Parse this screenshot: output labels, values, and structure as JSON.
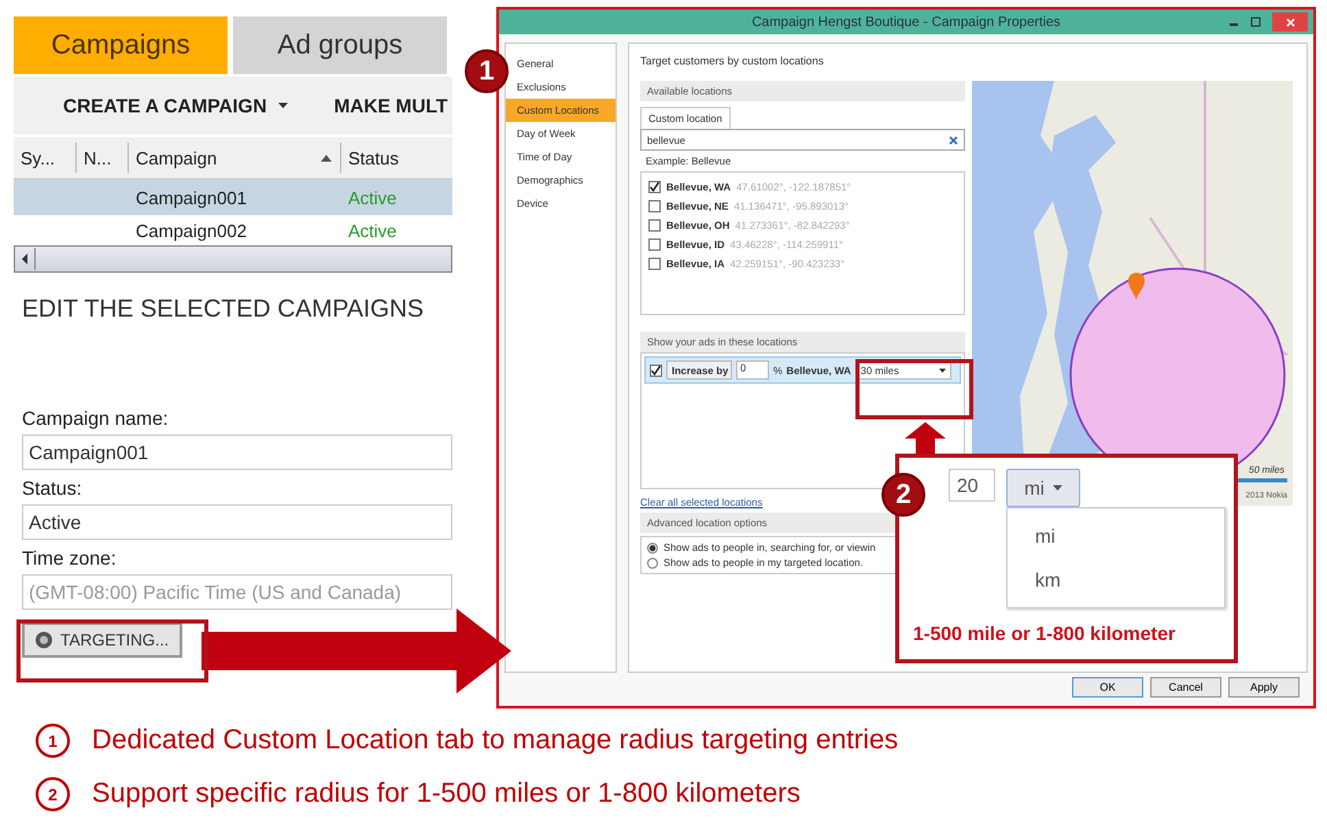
{
  "campaign_panel": {
    "tabs": [
      {
        "label": "Campaigns",
        "selected": true
      },
      {
        "label": "Ad groups",
        "selected": false
      }
    ],
    "toolbar": [
      {
        "label": "CREATE A CAMPAIGN",
        "dropdown": true
      },
      {
        "label": "MAKE MULT",
        "dropdown": false
      }
    ],
    "table": {
      "columns": [
        {
          "label": "Sy...",
          "sorted": false
        },
        {
          "label": "N...",
          "sorted": false
        },
        {
          "label": "Campaign",
          "sorted": true
        },
        {
          "label": "Status",
          "sorted": false
        }
      ],
      "rows": [
        {
          "campaign": "Campaign001",
          "status": "Active",
          "selected": true
        },
        {
          "campaign": "Campaign002",
          "status": "Active",
          "selected": false
        }
      ]
    },
    "edit": {
      "heading": "EDIT THE SELECTED CAMPAIGNS",
      "fields": [
        {
          "label": "Campaign name:",
          "value": "Campaign001",
          "disabled": false
        },
        {
          "label": "Status:",
          "value": "Active",
          "disabled": false
        },
        {
          "label": "Time zone:",
          "value": "(GMT-08:00) Pacific Time (US and Canada)",
          "disabled": true
        }
      ],
      "targeting_button": "TARGETING..."
    }
  },
  "dialog": {
    "title": "Campaign Hengst Boutique - Campaign Properties",
    "nav": [
      {
        "label": "General",
        "selected": false
      },
      {
        "label": "Exclusions",
        "selected": false
      },
      {
        "label": "Custom Locations",
        "selected": true
      },
      {
        "label": "Day of Week",
        "selected": false
      },
      {
        "label": "Time of Day",
        "selected": false
      },
      {
        "label": "Demographics",
        "selected": false
      },
      {
        "label": "Device",
        "selected": false
      }
    ],
    "heading": "Target customers by custom locations",
    "available": {
      "title": "Available locations",
      "tab": "Custom location",
      "search": "bellevue",
      "hint": "Example: Bellevue",
      "results": [
        {
          "name": "Bellevue, WA",
          "coords": "47.61002°, -122.187851°",
          "checked": true
        },
        {
          "name": "Bellevue, NE",
          "coords": "41.136471°, -95.893013°",
          "checked": false
        },
        {
          "name": "Bellevue, OH",
          "coords": "41.273361°, -82.842293°",
          "checked": false
        },
        {
          "name": "Bellevue, ID",
          "coords": "43.46228°, -114.259911°",
          "checked": false
        },
        {
          "name": "Bellevue, IA",
          "coords": "42.259151°, -90.423233°",
          "checked": false
        }
      ]
    },
    "targeted": {
      "title": "Show your ads in these locations",
      "rows": [
        {
          "checked": true,
          "bid_type": "Increase by",
          "bid": "0",
          "unit": "%",
          "location": "Bellevue, WA",
          "radius": "30 miles"
        }
      ]
    },
    "clear_link": "Clear all selected locations",
    "advanced": {
      "title": "Advanced location options",
      "options": [
        {
          "label": "Show ads to people in, searching for, or viewin",
          "selected": true
        },
        {
          "label": "Show ads to people in my targeted location.",
          "selected": false
        }
      ]
    },
    "map": {
      "scale": "50 miles",
      "attribution": "2013 Nokia"
    },
    "buttons": [
      "OK",
      "Cancel",
      "Apply"
    ]
  },
  "callouts": [
    {
      "number": "1"
    },
    {
      "number": "2",
      "radius": "20",
      "unit": "mi",
      "options": [
        "mi",
        "km"
      ],
      "note": "1-500 mile or 1-800 kilometer"
    }
  ],
  "legend": [
    {
      "number": "1",
      "text": "Dedicated Custom Location tab to manage radius targeting entries"
    },
    {
      "number": "2",
      "text": "Support specific radius for 1-500 miles or 1-800 kilometers"
    }
  ]
}
